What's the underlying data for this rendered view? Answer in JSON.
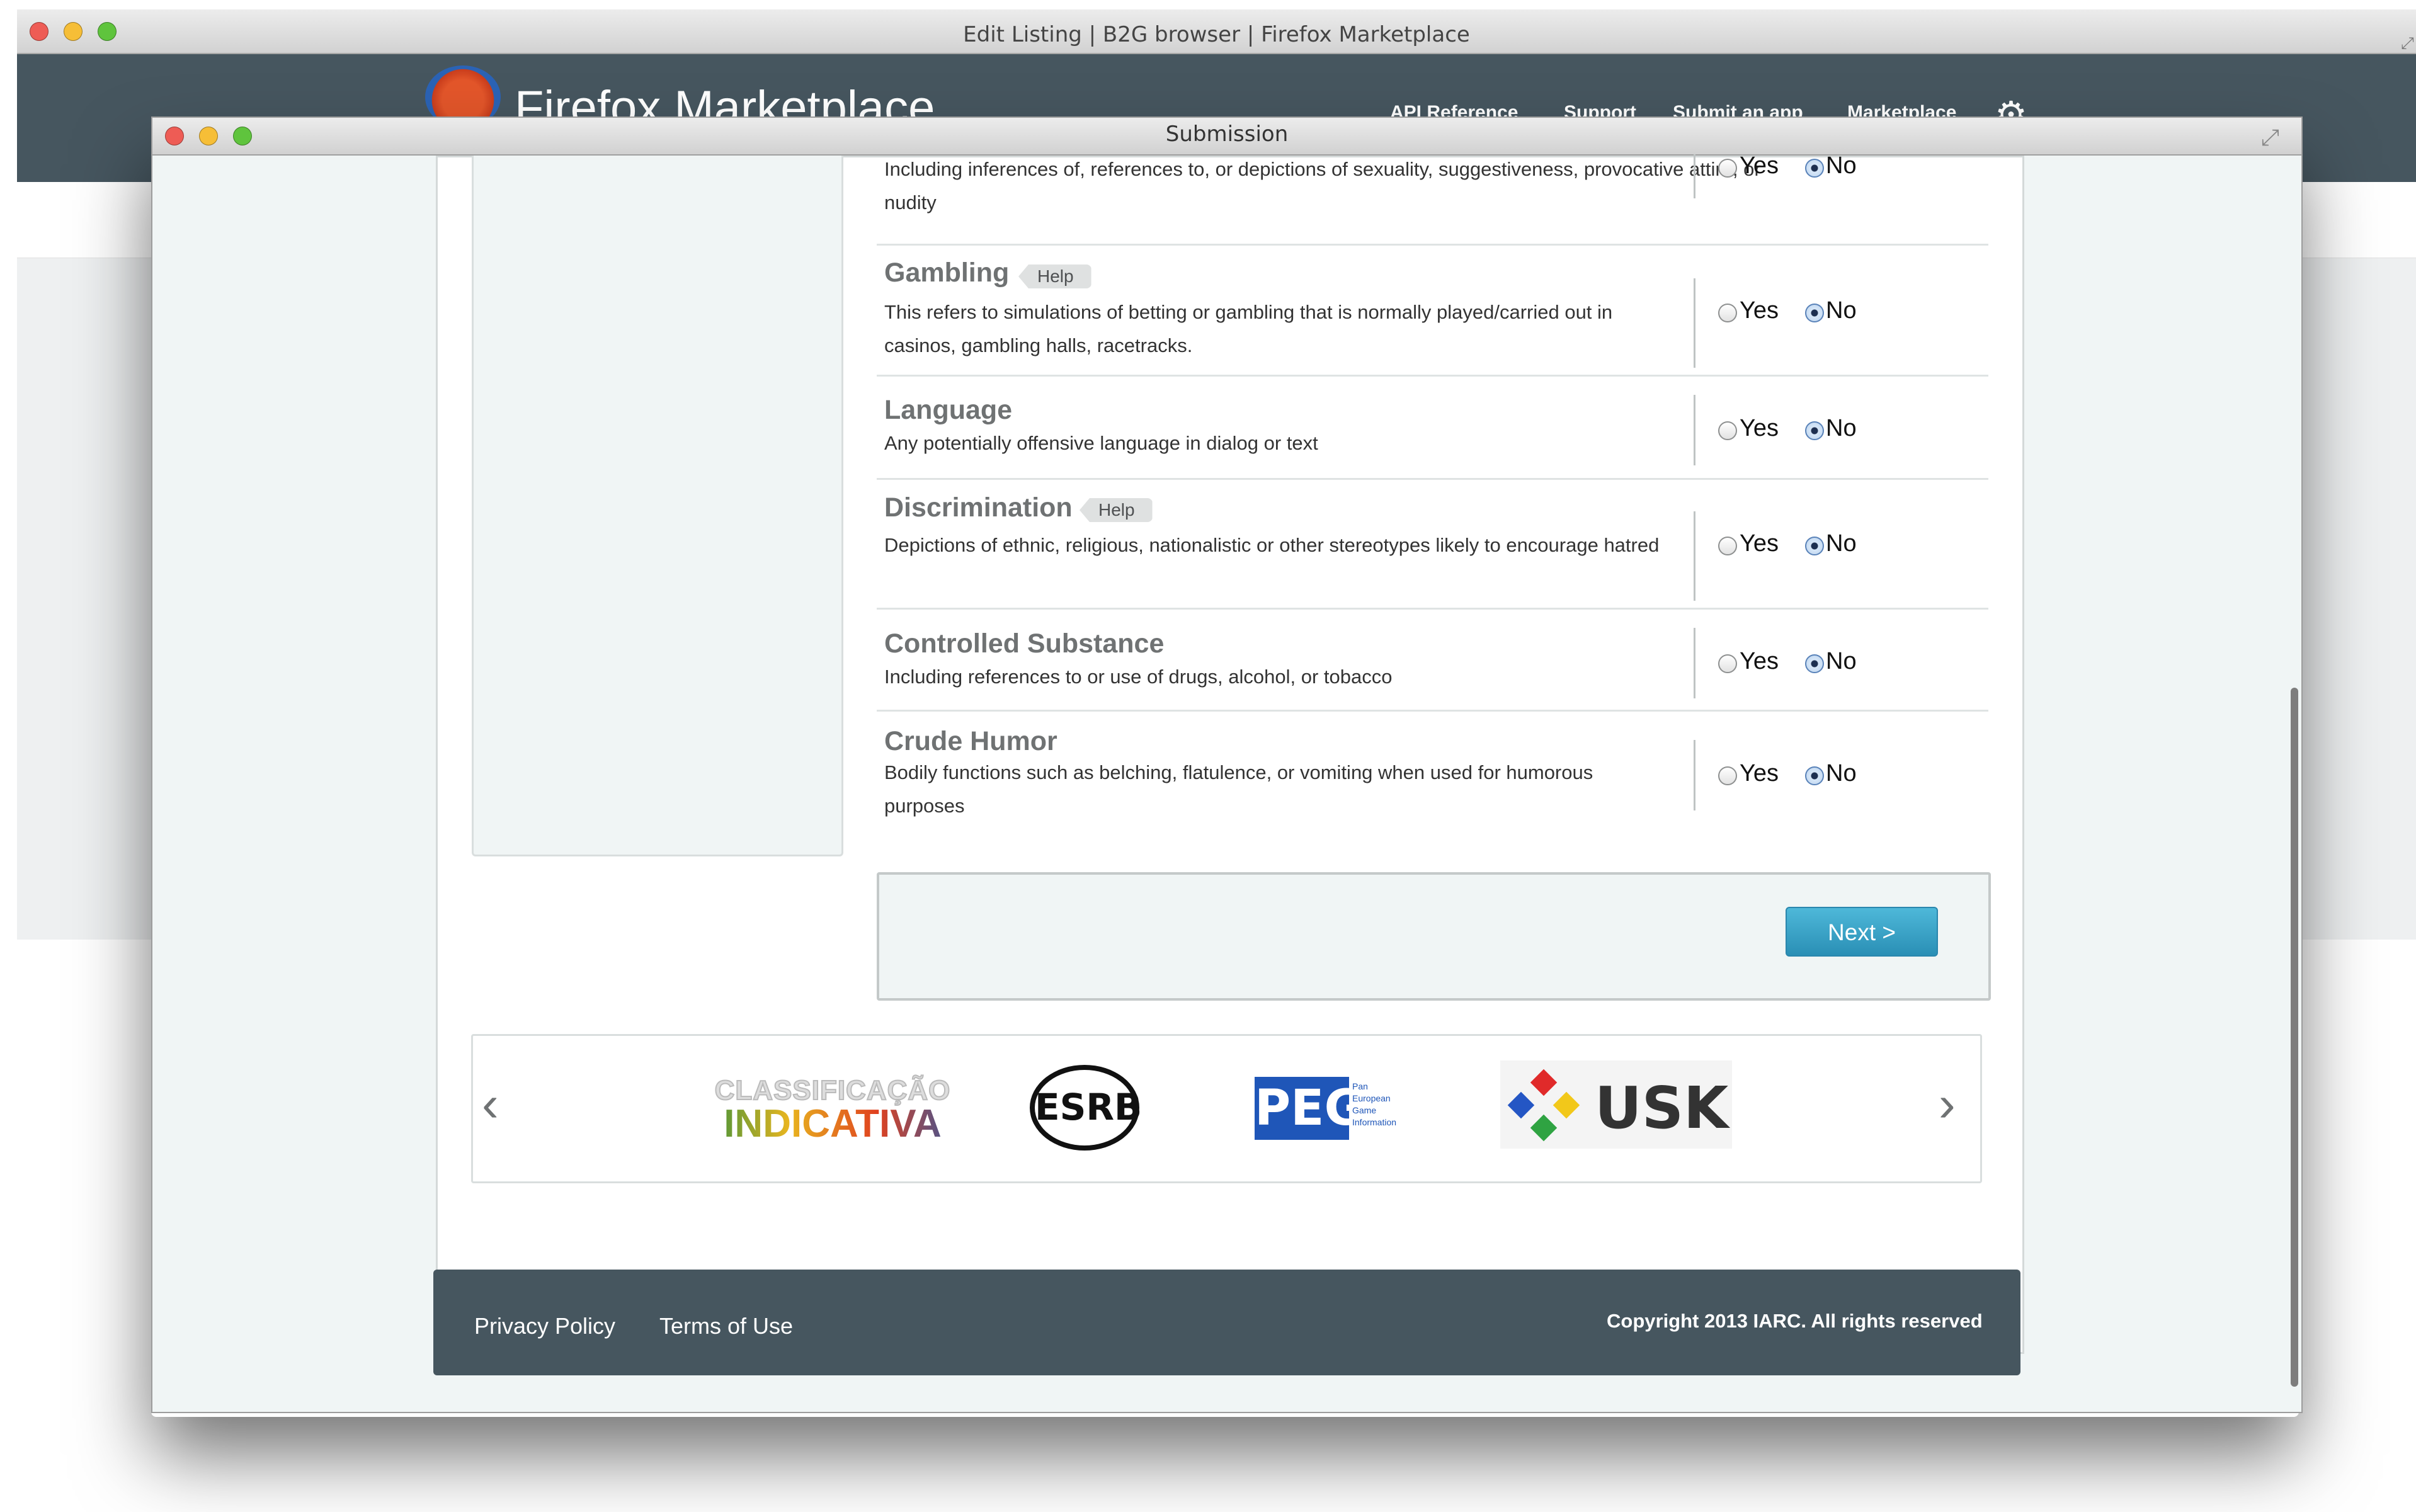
{
  "outer_window": {
    "title": "Edit Listing | B2G browser | Firefox Marketplace",
    "brand": "Firefox Marketplace",
    "nav": [
      "API Reference",
      "Support",
      "Submit an app",
      "Marketplace"
    ]
  },
  "modal": {
    "title": "Submission"
  },
  "descriptors": [
    {
      "title": "",
      "desc": "Including inferences of, references to, or depictions of sexuality, suggestiveness, provocative attire, or nudity",
      "help": "",
      "selected": "No"
    },
    {
      "title": "Gambling",
      "desc": "This refers to simulations of betting or gambling that is normally played/carried out in casinos, gambling halls, racetracks.",
      "help": "Help",
      "selected": "No"
    },
    {
      "title": "Language",
      "desc": "Any potentially offensive language in dialog or text",
      "help": "",
      "selected": "No"
    },
    {
      "title": "Discrimination",
      "desc": "Depictions of ethnic, religious, nationalistic or other stereotypes likely to encourage hatred",
      "help": "Help",
      "selected": "No"
    },
    {
      "title": "Controlled Substance",
      "desc": "Including references to or use of drugs, alcohol, or tobacco",
      "help": "",
      "selected": "No"
    },
    {
      "title": "Crude Humor",
      "desc": "Bodily functions such as belching, flatulence, or vomiting when used for humorous purposes",
      "help": "",
      "selected": "No"
    }
  ],
  "radio_labels": {
    "yes": "Yes",
    "no": "No"
  },
  "next_button": "Next >",
  "carousel": {
    "prev": "‹",
    "next": "›",
    "logos": {
      "classificacao_top": "CLASSIFICAÇÃO",
      "classificacao_bottom": "INDICATIVA",
      "esrb": "ESRB",
      "pegi": "PEGI",
      "pegi_small": "Pan European Game Information",
      "usk": "USK"
    }
  },
  "footer": {
    "privacy": "Privacy Policy",
    "terms": "Terms of Use",
    "copyright": "Copyright 2013 IARC. All rights reserved"
  },
  "colors": {
    "header_bg": "#46565f",
    "button_blue": "#2a8fb5",
    "panel_bg": "#f0f5f5"
  }
}
